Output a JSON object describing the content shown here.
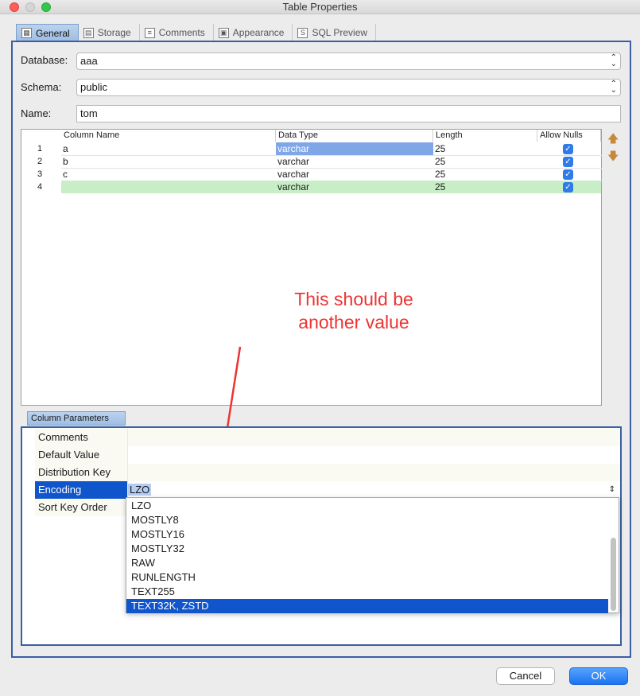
{
  "window": {
    "title": "Table Properties"
  },
  "tabs": [
    {
      "label": "General",
      "icon": "table-icon",
      "active": true
    },
    {
      "label": "Storage",
      "icon": "storage-icon"
    },
    {
      "label": "Comments",
      "icon": "comments-icon"
    },
    {
      "label": "Appearance",
      "icon": "appearance-icon"
    },
    {
      "label": "SQL Preview",
      "icon": "sql-icon"
    }
  ],
  "form": {
    "database_label": "Database:",
    "database_value": "aaa",
    "schema_label": "Schema:",
    "schema_value": "public",
    "name_label": "Name:",
    "name_value": "tom"
  },
  "columns_table": {
    "headers": [
      "Column Name",
      "Data Type",
      "Length",
      "Allow Nulls"
    ],
    "rows": [
      {
        "num": "1",
        "name": "a",
        "type": "varchar",
        "length": "25",
        "allow_nulls": true
      },
      {
        "num": "2",
        "name": "b",
        "type": "varchar",
        "length": "25",
        "allow_nulls": true
      },
      {
        "num": "3",
        "name": "c",
        "type": "varchar",
        "length": "25",
        "allow_nulls": true
      },
      {
        "num": "4",
        "name": "",
        "type": "varchar",
        "length": "25",
        "allow_nulls": true
      }
    ]
  },
  "annotation": {
    "line1": "This should be",
    "line2": "another value",
    "color": "#ee3333"
  },
  "column_parameters": {
    "tab_label": "Column Parameters",
    "rows": [
      {
        "key": "Comments",
        "value": ""
      },
      {
        "key": "Default Value",
        "value": ""
      },
      {
        "key": "Distribution Key",
        "value": ""
      },
      {
        "key": "Encoding",
        "value": "LZO",
        "selected": true
      },
      {
        "key": "Sort Key Order",
        "value": ""
      }
    ],
    "encoding_options": [
      "LZO",
      "MOSTLY8",
      "MOSTLY16",
      "MOSTLY32",
      "RAW",
      "RUNLENGTH",
      "TEXT255",
      "TEXT32K, ZSTD"
    ],
    "encoding_highlighted": "TEXT32K, ZSTD"
  },
  "buttons": {
    "cancel": "Cancel",
    "ok": "OK"
  },
  "colors": {
    "accent": "#1155cc",
    "new_row": "#c8eec8",
    "selection": "#7fa6e6"
  }
}
